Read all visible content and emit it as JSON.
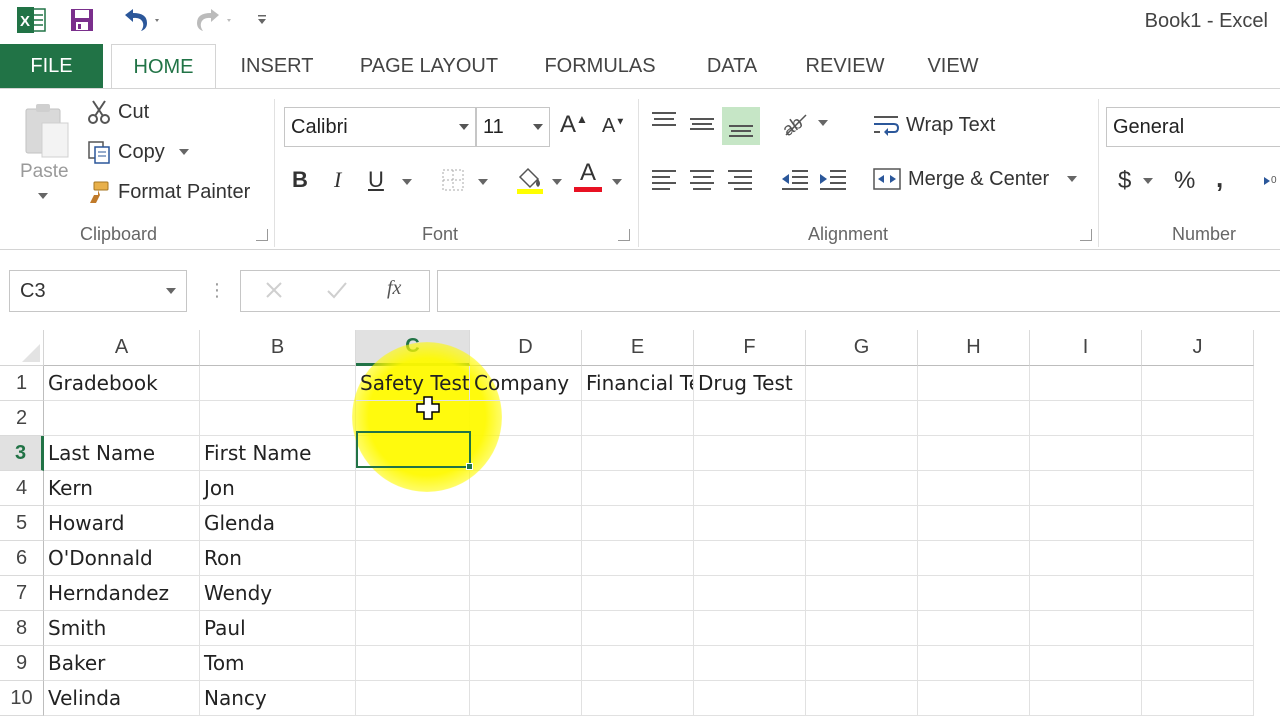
{
  "window": {
    "title": "Book1 - Excel"
  },
  "quick_access": {
    "icons": [
      "excel-logo",
      "save-icon",
      "undo-icon",
      "redo-icon",
      "customize-icon"
    ]
  },
  "tabs": [
    {
      "label": "FILE"
    },
    {
      "label": "HOME"
    },
    {
      "label": "INSERT"
    },
    {
      "label": "PAGE LAYOUT"
    },
    {
      "label": "FORMULAS"
    },
    {
      "label": "DATA"
    },
    {
      "label": "REVIEW"
    },
    {
      "label": "VIEW"
    }
  ],
  "active_tab": "HOME",
  "clipboard": {
    "group_label": "Clipboard",
    "paste": "Paste",
    "cut": "Cut",
    "copy": "Copy",
    "format_painter": "Format Painter"
  },
  "font": {
    "group_label": "Font",
    "font_name": "Calibri",
    "font_size": "11"
  },
  "alignment": {
    "group_label": "Alignment",
    "wrap_text": "Wrap Text",
    "merge_center": "Merge & Center"
  },
  "number": {
    "group_label": "Number",
    "format": "General",
    "currency": "$",
    "percent": "%",
    "comma": ","
  },
  "formula_bar": {
    "name_box": "C3",
    "fx": "fx",
    "formula": ""
  },
  "columns": [
    "A",
    "B",
    "C",
    "D",
    "E",
    "F",
    "G",
    "H",
    "I",
    "J"
  ],
  "selected_column": "C",
  "selected_row": "3",
  "rows": [
    {
      "num": "1",
      "A": "Gradebook",
      "B": "",
      "C": "Safety Test",
      "D": "Company",
      "E": "Financial Test",
      "F": "Drug Test"
    },
    {
      "num": "2",
      "A": "",
      "B": "",
      "C": "",
      "D": "",
      "E": "",
      "F": ""
    },
    {
      "num": "3",
      "A": "Last Name",
      "B": "First Name",
      "C": "",
      "D": "",
      "E": "",
      "F": ""
    },
    {
      "num": "4",
      "A": "Kern",
      "B": "Jon",
      "C": "",
      "D": "",
      "E": "",
      "F": ""
    },
    {
      "num": "5",
      "A": "Howard",
      "B": "Glenda",
      "C": "",
      "D": "",
      "E": "",
      "F": ""
    },
    {
      "num": "6",
      "A": "O'Donnald",
      "B": "Ron",
      "C": "",
      "D": "",
      "E": "",
      "F": ""
    },
    {
      "num": "7",
      "A": "Herndandez",
      "B": "Wendy",
      "C": "",
      "D": "",
      "E": "",
      "F": ""
    },
    {
      "num": "8",
      "A": "Smith",
      "B": "Paul",
      "C": "",
      "D": "",
      "E": "",
      "F": ""
    },
    {
      "num": "9",
      "A": "Baker",
      "B": "Tom",
      "C": "",
      "D": "",
      "E": "",
      "F": ""
    },
    {
      "num": "10",
      "A": "Velinda",
      "B": "Nancy",
      "C": "",
      "D": "",
      "E": "",
      "F": ""
    }
  ],
  "colors": {
    "accent": "#217346",
    "highlight": "#fff500",
    "font_color_bar": "#e81123"
  }
}
